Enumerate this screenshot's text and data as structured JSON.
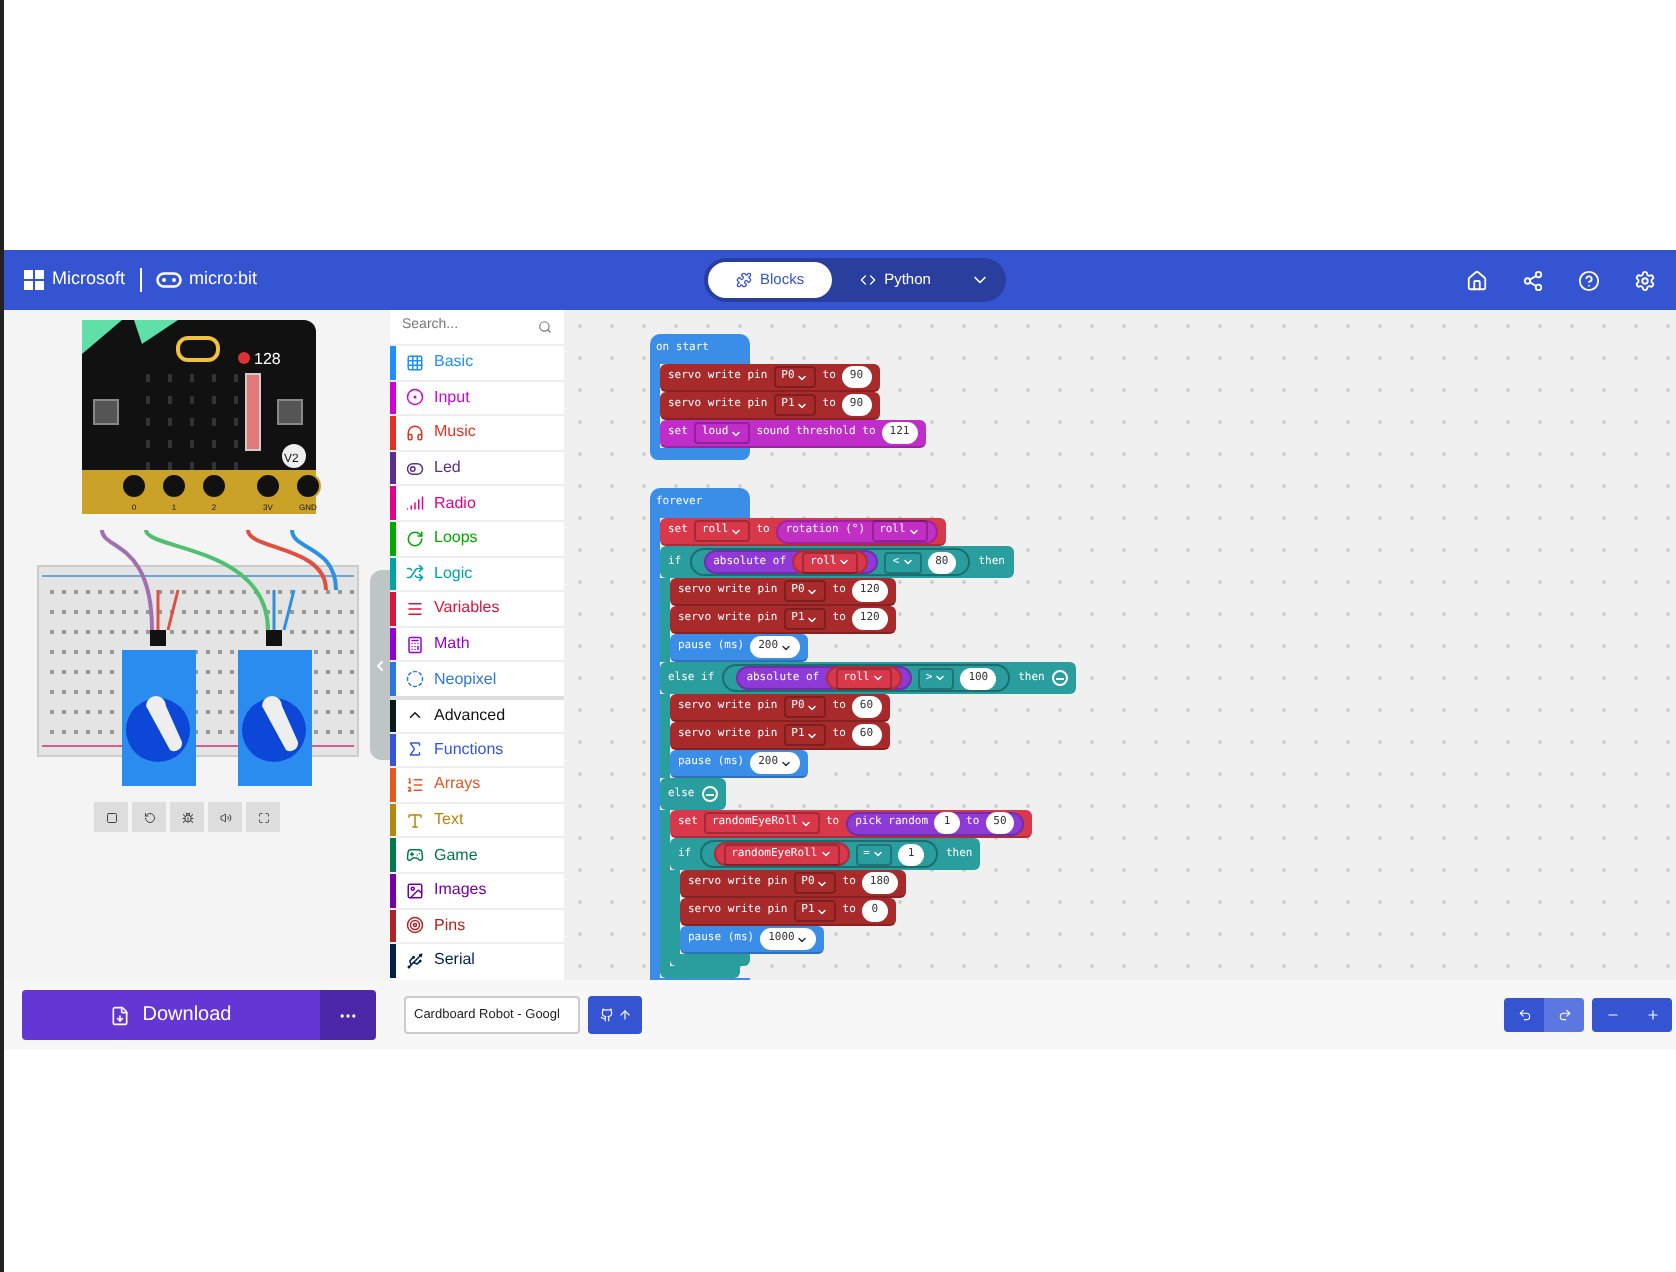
{
  "header": {
    "brand": "Microsoft",
    "product": "micro:bit",
    "modes": [
      {
        "label": "Blocks",
        "selected": true
      },
      {
        "label": "Python",
        "selected": false
      }
    ]
  },
  "simulator": {
    "reading": "128",
    "badge": "V2",
    "pins": [
      "0",
      "1",
      "2",
      "3V",
      "GND"
    ]
  },
  "toolbox": {
    "search_placeholder": "Search...",
    "categories": [
      {
        "kind": "category",
        "label": "Basic",
        "color": "#1e90ff"
      },
      {
        "kind": "category",
        "label": "Input",
        "color": "#d400d4"
      },
      {
        "kind": "category",
        "label": "Music",
        "color": "#e63022"
      },
      {
        "kind": "category",
        "label": "Led",
        "color": "#5c2d91"
      },
      {
        "kind": "category",
        "label": "Radio",
        "color": "#e3008c"
      },
      {
        "kind": "category",
        "label": "Loops",
        "color": "#00aa00"
      },
      {
        "kind": "category",
        "label": "Logic",
        "color": "#00a4a6"
      },
      {
        "kind": "category",
        "label": "Variables",
        "color": "#dc143c"
      },
      {
        "kind": "category",
        "label": "Math",
        "color": "#9400d3"
      },
      {
        "kind": "category",
        "label": "Neopixel",
        "color": "#2b78e4"
      },
      {
        "kind": "section",
        "label": "Advanced",
        "color": "#0a1a1a"
      },
      {
        "kind": "category",
        "label": "Functions",
        "color": "#3455db"
      },
      {
        "kind": "category",
        "label": "Arrays",
        "color": "#e65722"
      },
      {
        "kind": "category",
        "label": "Text",
        "color": "#b8860b"
      },
      {
        "kind": "category",
        "label": "Game",
        "color": "#007a4b"
      },
      {
        "kind": "category",
        "label": "Images",
        "color": "#7600a8"
      },
      {
        "kind": "category",
        "label": "Pins",
        "color": "#b22222"
      },
      {
        "kind": "category",
        "label": "Serial",
        "color": "#002050"
      }
    ]
  },
  "scripts": [
    {
      "kind": "hat",
      "color": "#3b8ee8",
      "label": "on start",
      "children": [
        {
          "kind": "statement",
          "color": "#a82a2a",
          "parts": [
            {
              "kind": "label",
              "text": "servo write pin"
            },
            {
              "kind": "dropdown",
              "text": "P0"
            },
            {
              "kind": "label",
              "text": "to"
            },
            {
              "kind": "number",
              "text": "90"
            }
          ]
        },
        {
          "kind": "statement",
          "color": "#a82a2a",
          "parts": [
            {
              "kind": "label",
              "text": "servo write pin"
            },
            {
              "kind": "dropdown",
              "text": "P1"
            },
            {
              "kind": "label",
              "text": "to"
            },
            {
              "kind": "number",
              "text": "90"
            }
          ]
        },
        {
          "kind": "statement",
          "color": "#c02dc8",
          "parts": [
            {
              "kind": "label",
              "text": "set"
            },
            {
              "kind": "dropdown",
              "text": "loud"
            },
            {
              "kind": "label",
              "text": "sound threshold to"
            },
            {
              "kind": "number",
              "text": "121"
            }
          ]
        }
      ]
    },
    {
      "kind": "hat",
      "color": "#3b8ee8",
      "label": "forever",
      "children": [
        {
          "kind": "statement",
          "color": "#d8384a",
          "parts": [
            {
              "kind": "label",
              "text": "set"
            },
            {
              "kind": "dropdown",
              "text": "roll"
            },
            {
              "kind": "label",
              "text": "to"
            },
            {
              "kind": "reporter",
              "color": "#c22fc4",
              "parts": [
                {
                  "kind": "label",
                  "text": "rotation (°)"
                },
                {
                  "kind": "dropdown",
                  "text": "roll"
                }
              ]
            }
          ]
        },
        {
          "kind": "if",
          "color": "#2a9d9e",
          "clauses": [
            {
              "parts": [
                {
                  "kind": "label",
                  "text": "if"
                },
                {
                  "kind": "boolean",
                  "color": "#2a9d9e",
                  "parts": [
                    {
                      "kind": "reporter",
                      "color": "#8e3ad6",
                      "parts": [
                        {
                          "kind": "label",
                          "text": "absolute of"
                        },
                        {
                          "kind": "reporter",
                          "color": "#d8384a",
                          "parts": [
                            {
                              "kind": "dropdown",
                              "text": "roll"
                            }
                          ]
                        }
                      ]
                    },
                    {
                      "kind": "dropdown",
                      "text": "<"
                    },
                    {
                      "kind": "number",
                      "text": "80"
                    }
                  ]
                },
                {
                  "kind": "label",
                  "text": "then"
                }
              ],
              "children": [
                {
                  "kind": "statement",
                  "color": "#a82a2a",
                  "parts": [
                    {
                      "kind": "label",
                      "text": "servo write pin"
                    },
                    {
                      "kind": "dropdown",
                      "text": "P0"
                    },
                    {
                      "kind": "label",
                      "text": "to"
                    },
                    {
                      "kind": "number",
                      "text": "120"
                    }
                  ]
                },
                {
                  "kind": "statement",
                  "color": "#a82a2a",
                  "parts": [
                    {
                      "kind": "label",
                      "text": "servo write pin"
                    },
                    {
                      "kind": "dropdown",
                      "text": "P1"
                    },
                    {
                      "kind": "label",
                      "text": "to"
                    },
                    {
                      "kind": "number",
                      "text": "120"
                    }
                  ]
                },
                {
                  "kind": "statement",
                  "color": "#3b8ee8",
                  "parts": [
                    {
                      "kind": "label",
                      "text": "pause (ms)"
                    },
                    {
                      "kind": "number_menu",
                      "text": "200"
                    }
                  ]
                }
              ]
            },
            {
              "parts": [
                {
                  "kind": "label",
                  "text": "else if"
                },
                {
                  "kind": "boolean",
                  "color": "#2a9d9e",
                  "parts": [
                    {
                      "kind": "reporter",
                      "color": "#8e3ad6",
                      "parts": [
                        {
                          "kind": "label",
                          "text": "absolute of"
                        },
                        {
                          "kind": "reporter",
                          "color": "#d8384a",
                          "parts": [
                            {
                              "kind": "dropdown",
                              "text": "roll"
                            }
                          ]
                        }
                      ]
                    },
                    {
                      "kind": "dropdown",
                      "text": ">"
                    },
                    {
                      "kind": "number",
                      "text": "100"
                    }
                  ]
                },
                {
                  "kind": "label",
                  "text": "then"
                }
              ],
              "children": [
                {
                  "kind": "statement",
                  "color": "#a82a2a",
                  "parts": [
                    {
                      "kind": "label",
                      "text": "servo write pin"
                    },
                    {
                      "kind": "dropdown",
                      "text": "P0"
                    },
                    {
                      "kind": "label",
                      "text": "to"
                    },
                    {
                      "kind": "number",
                      "text": "60"
                    }
                  ]
                },
                {
                  "kind": "statement",
                  "color": "#a82a2a",
                  "parts": [
                    {
                      "kind": "label",
                      "text": "servo write pin"
                    },
                    {
                      "kind": "dropdown",
                      "text": "P1"
                    },
                    {
                      "kind": "label",
                      "text": "to"
                    },
                    {
                      "kind": "number",
                      "text": "60"
                    }
                  ]
                },
                {
                  "kind": "statement",
                  "color": "#3b8ee8",
                  "parts": [
                    {
                      "kind": "label",
                      "text": "pause (ms)"
                    },
                    {
                      "kind": "number_menu",
                      "text": "200"
                    }
                  ]
                }
              ]
            },
            {
              "parts": [
                {
                  "kind": "label",
                  "text": "else"
                }
              ],
              "children": [
                {
                  "kind": "statement",
                  "color": "#d8384a",
                  "parts": [
                    {
                      "kind": "label",
                      "text": "set"
                    },
                    {
                      "kind": "dropdown",
                      "text": "randomEyeRoll"
                    },
                    {
                      "kind": "label",
                      "text": "to"
                    },
                    {
                      "kind": "reporter",
                      "color": "#8e3ad6",
                      "parts": [
                        {
                          "kind": "label",
                          "text": "pick random"
                        },
                        {
                          "kind": "number",
                          "text": "1"
                        },
                        {
                          "kind": "label",
                          "text": "to"
                        },
                        {
                          "kind": "number",
                          "text": "50"
                        }
                      ]
                    }
                  ]
                },
                {
                  "kind": "if",
                  "color": "#2a9d9e",
                  "clauses": [
                    {
                      "parts": [
                        {
                          "kind": "label",
                          "text": "if"
                        },
                        {
                          "kind": "boolean",
                          "color": "#2a9d9e",
                          "parts": [
                            {
                              "kind": "reporter",
                              "color": "#d8384a",
                              "parts": [
                                {
                                  "kind": "dropdown",
                                  "text": "randomEyeRoll"
                                }
                              ]
                            },
                            {
                              "kind": "dropdown",
                              "text": "="
                            },
                            {
                              "kind": "number",
                              "text": "1"
                            }
                          ]
                        },
                        {
                          "kind": "label",
                          "text": "then"
                        }
                      ],
                      "children": [
                        {
                          "kind": "statement",
                          "color": "#a82a2a",
                          "parts": [
                            {
                              "kind": "label",
                              "text": "servo write pin"
                            },
                            {
                              "kind": "dropdown",
                              "text": "P0"
                            },
                            {
                              "kind": "label",
                              "text": "to"
                            },
                            {
                              "kind": "number",
                              "text": "180"
                            }
                          ]
                        },
                        {
                          "kind": "statement",
                          "color": "#a82a2a",
                          "parts": [
                            {
                              "kind": "label",
                              "text": "servo write pin"
                            },
                            {
                              "kind": "dropdown",
                              "text": "P1"
                            },
                            {
                              "kind": "label",
                              "text": "to"
                            },
                            {
                              "kind": "number",
                              "text": "0"
                            }
                          ]
                        },
                        {
                          "kind": "statement",
                          "color": "#3b8ee8",
                          "parts": [
                            {
                              "kind": "label",
                              "text": "pause (ms)"
                            },
                            {
                              "kind": "number_menu",
                              "text": "1000"
                            }
                          ]
                        }
                      ]
                    }
                  ]
                }
              ]
            }
          ]
        }
      ]
    }
  ],
  "bottom_bar": {
    "download": "Download",
    "project_name": "Cardboard Robot - Googl"
  }
}
